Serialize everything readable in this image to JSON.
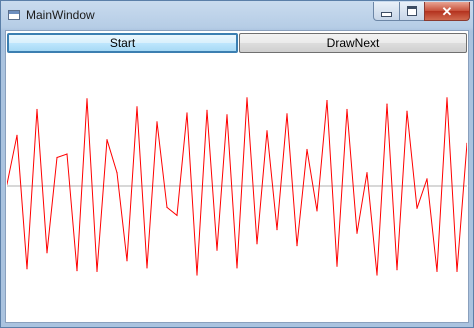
{
  "window": {
    "title": "MainWindow",
    "close_glyph": "✕"
  },
  "toolbar": {
    "start_label": "Start",
    "drawnext_label": "DrawNext"
  },
  "chart_data": {
    "type": "line",
    "xlabel": "",
    "ylabel": "",
    "ylim": [
      -100,
      100
    ],
    "grid": false,
    "axis_line": {
      "y": 0,
      "color": "#b0b0b0"
    },
    "series": [
      {
        "color": "#ff0000",
        "values": [
          2,
          57,
          -93,
          86,
          -75,
          32,
          36,
          -95,
          98,
          -96,
          52,
          15,
          -84,
          89,
          -92,
          72,
          -24,
          -33,
          82,
          -100,
          85,
          -72,
          80,
          -92,
          99,
          -65,
          62,
          -49,
          81,
          -67,
          41,
          -28,
          96,
          -90,
          86,
          -53,
          15,
          -100,
          92,
          -94,
          84,
          -25,
          8,
          -96,
          99,
          -96,
          48
        ]
      }
    ]
  }
}
